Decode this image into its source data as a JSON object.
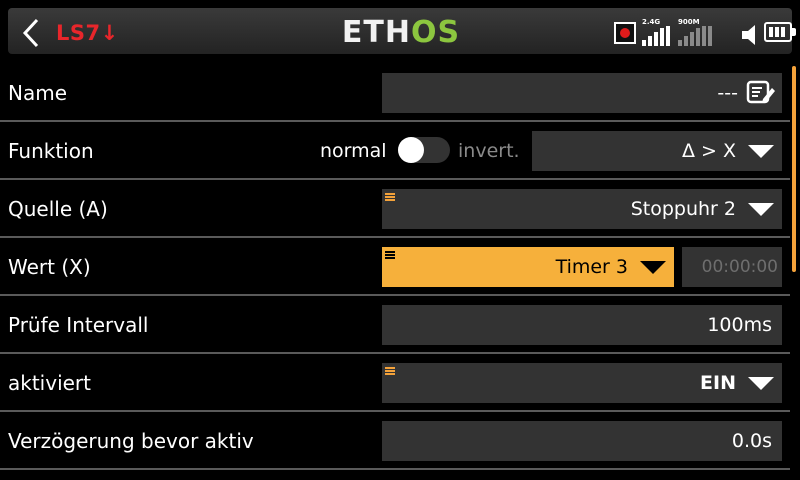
{
  "header": {
    "logical_switch": "LS7↓",
    "logo": {
      "part1": "ETH",
      "part2": "OS"
    },
    "status": {
      "label_24g": "2.4G",
      "label_900m": "900M"
    }
  },
  "rows": {
    "name": {
      "label": "Name",
      "value": "---"
    },
    "funktion": {
      "label": "Funktion",
      "toggle_left": "normal",
      "toggle_right": "invert.",
      "value": "Δ > X"
    },
    "quelle": {
      "label": "Quelle (A)",
      "value": "Stoppuhr 2"
    },
    "wert": {
      "label": "Wert (X)",
      "value": "Timer 3",
      "time": "00:00:00"
    },
    "pruefe": {
      "label": "Prüfe Intervall",
      "value": "100ms"
    },
    "aktiviert": {
      "label": "aktiviert",
      "value": "EIN"
    },
    "verzoegerung": {
      "label": "Verzögerung bevor aktiv",
      "value": "0.0s"
    }
  },
  "colors": {
    "accent": "#f6b03b",
    "field_bg": "#333333",
    "ls_red": "#e8262b",
    "logo_green": "#8cc63f"
  },
  "icons": [
    "back-icon",
    "record-icon",
    "signal-24g-icon",
    "signal-900m-icon",
    "speaker-icon",
    "battery-icon",
    "edit-icon",
    "chevron-down-icon",
    "menu-mark-icon"
  ]
}
